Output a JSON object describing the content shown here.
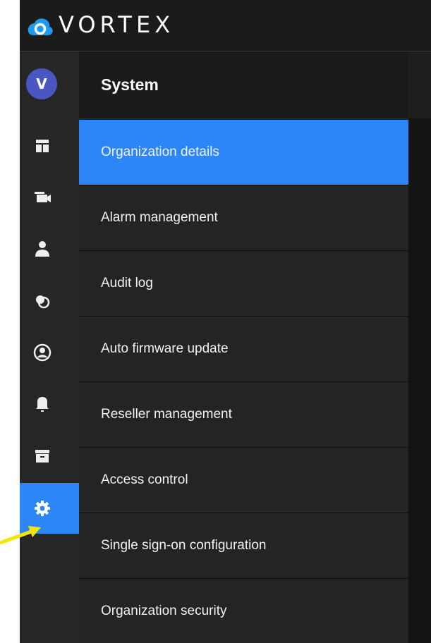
{
  "brand": {
    "name": "VORTEX"
  },
  "user": {
    "initial": "V"
  },
  "rail": {
    "items": [
      {
        "icon": "dashboard-icon"
      },
      {
        "icon": "camera-icon"
      },
      {
        "icon": "person-icon"
      },
      {
        "icon": "overlap-circles-icon"
      },
      {
        "icon": "user-circle-icon"
      },
      {
        "icon": "bell-icon"
      },
      {
        "icon": "archive-icon"
      },
      {
        "icon": "gear-icon",
        "active": true
      }
    ]
  },
  "panel": {
    "title": "System",
    "items": [
      {
        "label": "Organization details",
        "active": true
      },
      {
        "label": "Alarm management"
      },
      {
        "label": "Audit log"
      },
      {
        "label": "Auto firmware update"
      },
      {
        "label": "Reseller management"
      },
      {
        "label": "Access control"
      },
      {
        "label": "Single sign-on configuration"
      },
      {
        "label": "Organization security"
      }
    ]
  },
  "colors": {
    "accent": "#2d86f8",
    "annotation_arrow": "#f5e600"
  }
}
